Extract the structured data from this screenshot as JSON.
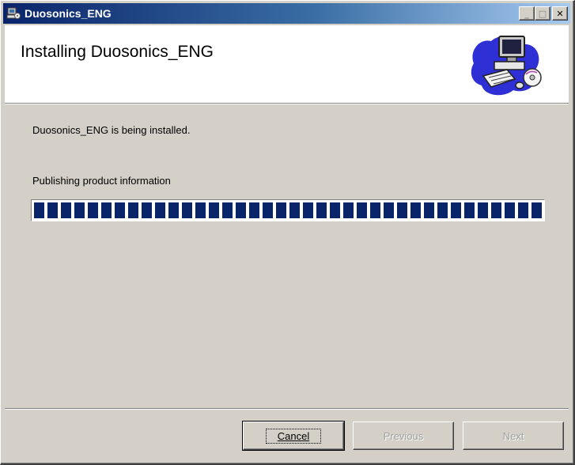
{
  "window": {
    "title": "Duosonics_ENG",
    "controls": {
      "minimize": "_",
      "maximize": "□",
      "close": "✕"
    }
  },
  "header": {
    "title": "Installing Duosonics_ENG",
    "graphic_icon": "computer-cd-icon"
  },
  "content": {
    "status_text": "Duosonics_ENG is being installed.",
    "action_text": "Publishing product information",
    "progress": 1.0
  },
  "buttons": {
    "cancel": "Cancel",
    "previous": "Previous",
    "next": "Next"
  },
  "colors": {
    "titlebar_start": "#0a246a",
    "titlebar_end": "#a6caf0",
    "progress_block": "#0a246a",
    "dialog_face": "#d4d0c8"
  }
}
